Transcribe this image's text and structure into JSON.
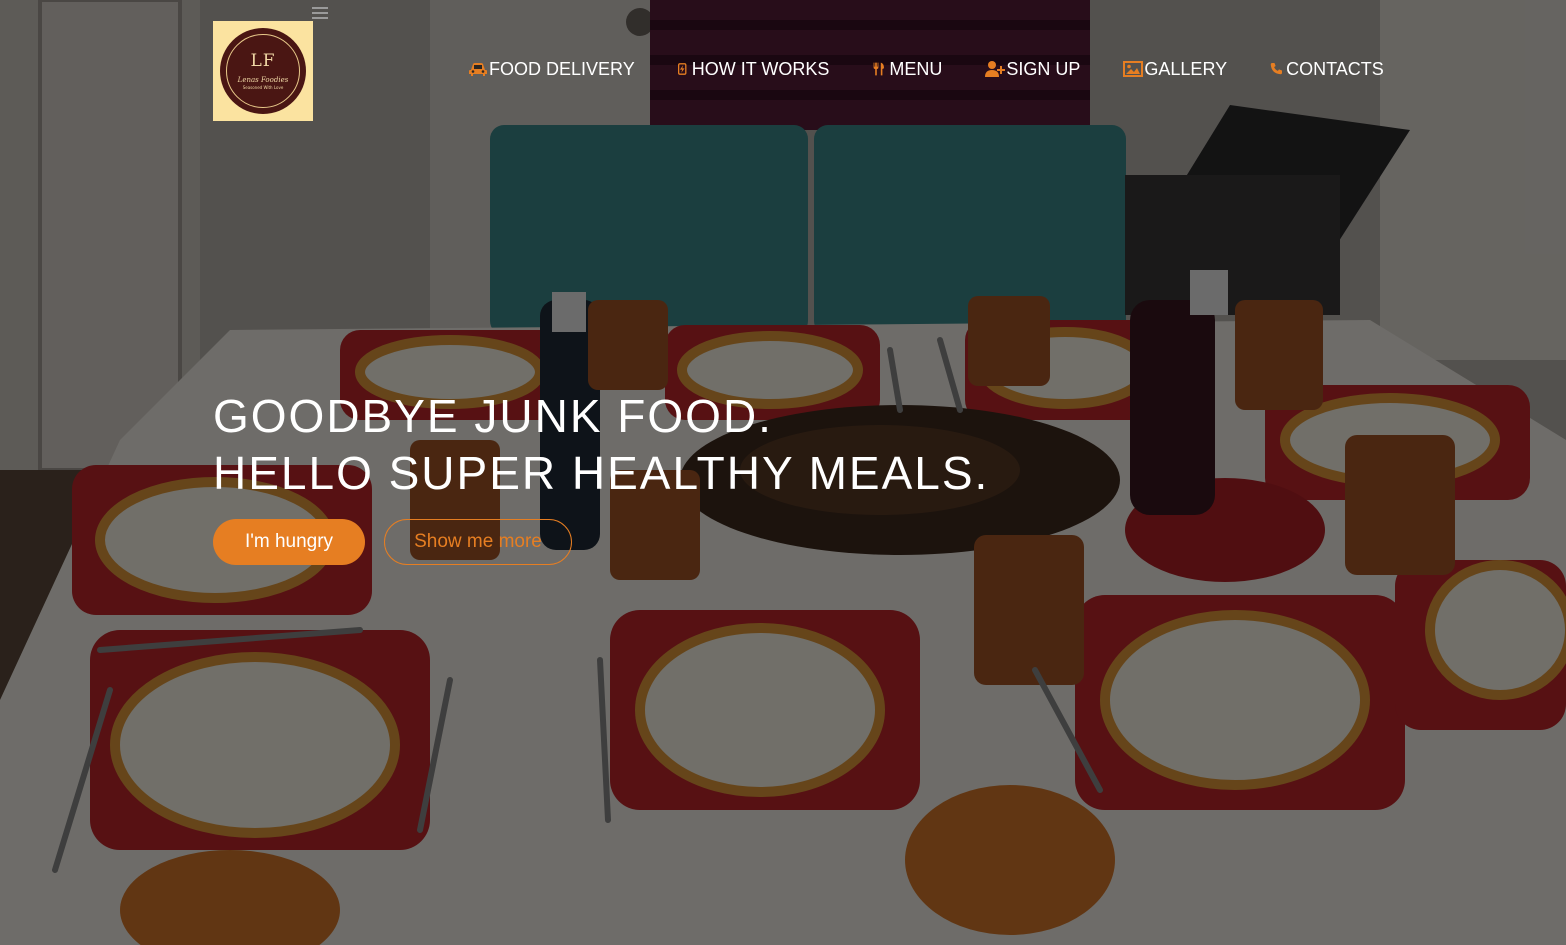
{
  "brand": {
    "logo_monogram": "LF",
    "logo_name": "Lenas Foodies",
    "logo_tagline": "Seasoned With Love",
    "logo_background": "#fbe3a0",
    "logo_circle": "#4a1613"
  },
  "nav": {
    "items": [
      {
        "label": "FOOD DELIVERY",
        "icon": "car-icon"
      },
      {
        "label": "HOW IT WORKS",
        "icon": "bolt-icon"
      },
      {
        "label": "MENU",
        "icon": "utensils-icon"
      },
      {
        "label": "SIGN UP",
        "icon": "user-plus-icon"
      },
      {
        "label": "GALLERY",
        "icon": "image-icon"
      },
      {
        "label": "CONTACTS",
        "icon": "phone-icon"
      }
    ],
    "icon_color": "#e67e22",
    "menu_toggle_icon": "hamburger-icon"
  },
  "hero": {
    "headline_line1": "GOODBYE JUNK FOOD.",
    "headline_line2": "HELLO SUPER HEALTHY MEALS.",
    "primary_button": "I'm hungry",
    "secondary_button": "Show me more",
    "accent": "#e67e22"
  }
}
